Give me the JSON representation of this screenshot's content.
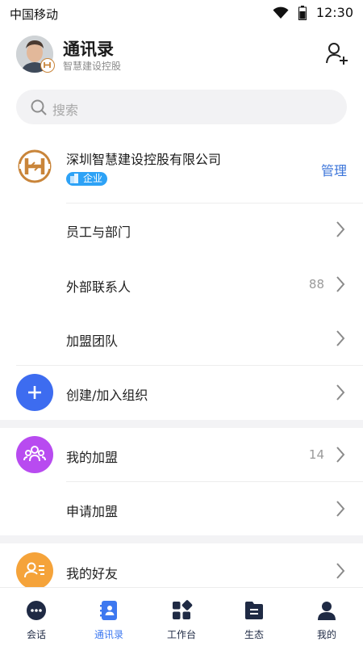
{
  "status_bar": {
    "carrier": "中国移动",
    "time": "12:30"
  },
  "header": {
    "title": "通讯录",
    "subtitle": "智慧建设控股",
    "add_icon": "add-contact-icon"
  },
  "search": {
    "placeholder": "搜索"
  },
  "organization": {
    "name": "深圳智慧建设控股有限公司",
    "badge": "企业",
    "manage": "管理"
  },
  "org_items": [
    {
      "label": "员工与部门"
    },
    {
      "label": "外部联系人",
      "count": "88"
    },
    {
      "label": "加盟团队"
    }
  ],
  "create_org": {
    "label": "创建/加入组织",
    "icon": "plus-icon"
  },
  "alliance": [
    {
      "label": "我的加盟",
      "count": "14",
      "icon": "people-icon"
    },
    {
      "label": "申请加盟"
    }
  ],
  "friends": {
    "label": "我的好友",
    "icon": "friend-list-icon"
  },
  "tabs": [
    {
      "label": "会话",
      "icon": "chat-icon"
    },
    {
      "label": "通讯录",
      "icon": "contacts-icon",
      "active": true
    },
    {
      "label": "工作台",
      "icon": "workbench-icon"
    },
    {
      "label": "生态",
      "icon": "ecology-icon"
    },
    {
      "label": "我的",
      "icon": "profile-icon"
    }
  ],
  "colors": {
    "accent": "#3d78f0",
    "manage": "#3b74d9",
    "create": "#3d6cf0",
    "alliance": "#b84bf0",
    "friends": "#f5a33a",
    "nav": "#1f2a44"
  }
}
